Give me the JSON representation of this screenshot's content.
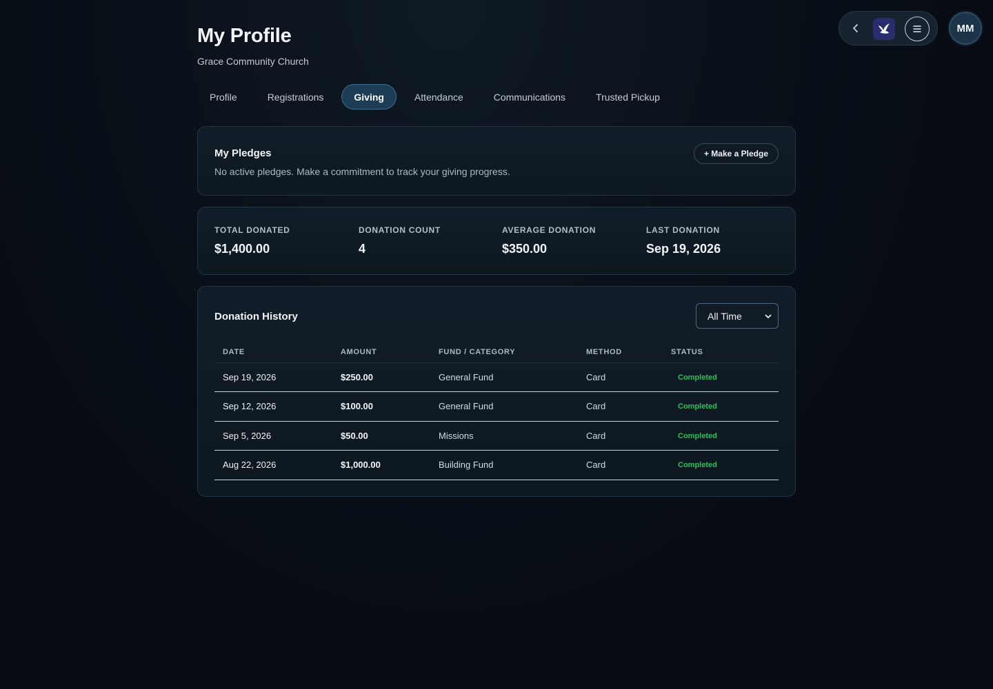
{
  "header": {
    "title": "My Profile",
    "subtitle": "Grace Community Church"
  },
  "nav": {
    "back_icon": "chevron-left-icon",
    "logo_icon": "dove-logo-icon",
    "menu_icon": "menu-icon",
    "avatar_initials": "MM"
  },
  "tabs": [
    {
      "label": "Profile",
      "active": false
    },
    {
      "label": "Registrations",
      "active": false
    },
    {
      "label": "Giving",
      "active": true
    },
    {
      "label": "Attendance",
      "active": false
    },
    {
      "label": "Communications",
      "active": false
    },
    {
      "label": "Trusted Pickup",
      "active": false
    }
  ],
  "pledges": {
    "title": "My Pledges",
    "empty_text": "No active pledges. Make a commitment to track your giving progress.",
    "button_label": "+ Make a Pledge"
  },
  "stats": [
    {
      "label": "TOTAL DONATED",
      "value": "$1,400.00"
    },
    {
      "label": "DONATION COUNT",
      "value": "4"
    },
    {
      "label": "AVERAGE DONATION",
      "value": "$350.00"
    },
    {
      "label": "LAST DONATION",
      "value": "Sep 19, 2026"
    }
  ],
  "history": {
    "title": "Donation History",
    "range_selected": "All Time",
    "columns": [
      "DATE",
      "AMOUNT",
      "FUND / CATEGORY",
      "METHOD",
      "STATUS"
    ],
    "rows": [
      {
        "date": "Sep 19, 2026",
        "amount": "$250.00",
        "fund": "General Fund",
        "method": "Card",
        "status": "Completed"
      },
      {
        "date": "Sep 12, 2026",
        "amount": "$100.00",
        "fund": "General Fund",
        "method": "Card",
        "status": "Completed"
      },
      {
        "date": "Sep 5, 2026",
        "amount": "$50.00",
        "fund": "Missions",
        "method": "Card",
        "status": "Completed"
      },
      {
        "date": "Aug 22, 2026",
        "amount": "$1,000.00",
        "fund": "Building Fund",
        "method": "Card",
        "status": "Completed"
      }
    ]
  },
  "colors": {
    "background": "#070c14",
    "card": "#111d28",
    "active_tab": "#1d3d56",
    "status_completed": "#2fbf5d"
  }
}
